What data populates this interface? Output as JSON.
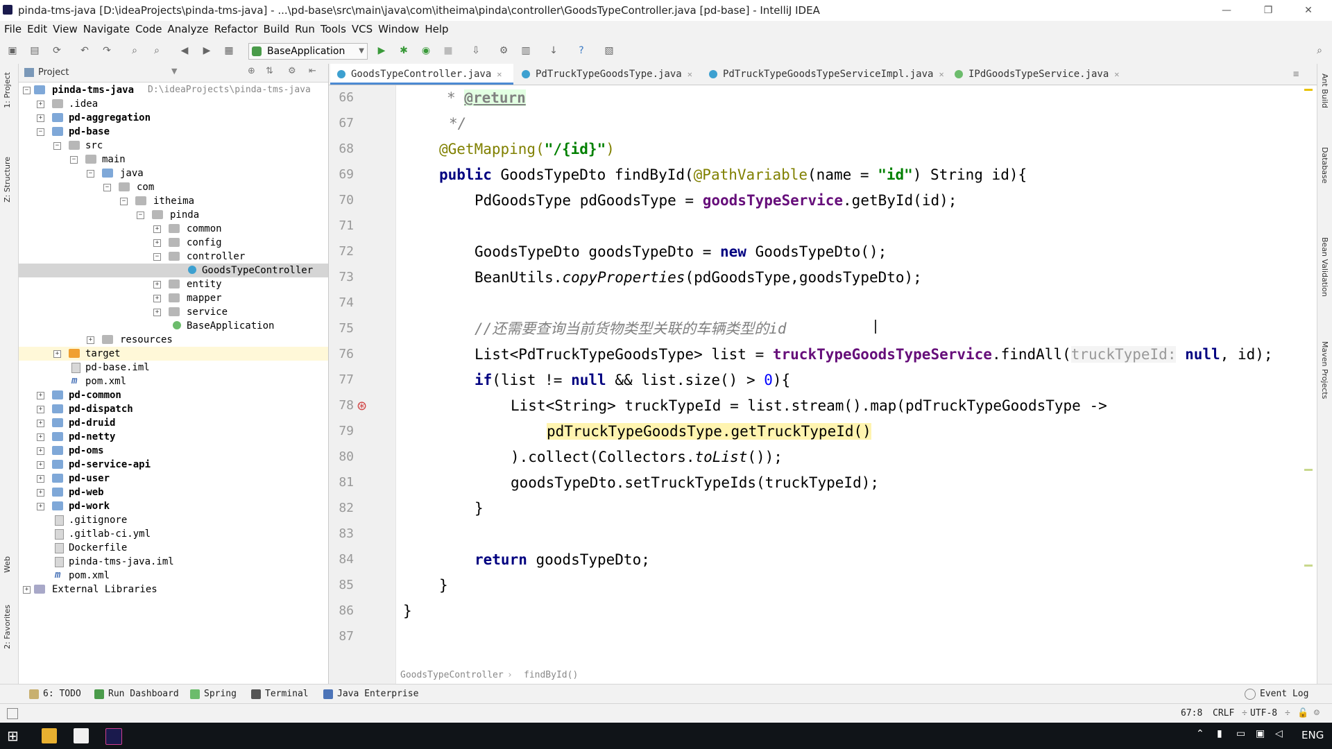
{
  "window": {
    "title": "pinda-tms-java [D:\\ideaProjects\\pinda-tms-java] - ...\\pd-base\\src\\main\\java\\com\\itheima\\pinda\\controller\\GoodsTypeController.java [pd-base] - IntelliJ IDEA",
    "minimize": "—",
    "maximize": "❐",
    "close": "✕"
  },
  "menu": [
    "File",
    "Edit",
    "View",
    "Navigate",
    "Code",
    "Analyze",
    "Refactor",
    "Build",
    "Run",
    "Tools",
    "VCS",
    "Window",
    "Help"
  ],
  "toolbar": {
    "run_config": "BaseApplication"
  },
  "left_strip": {
    "project": "1: Project",
    "structure": "Z: Structure",
    "web": "Web",
    "favorites": "2: Favorites"
  },
  "right_strip": {
    "ant": "Ant Build",
    "database": "Database",
    "bean": "Bean Validation",
    "maven": "Maven Projects"
  },
  "project_panel": {
    "title": "Project",
    "tree": [
      {
        "label": "pinda-tms-java",
        "path": "D:\\ideaProjects\\pinda-tms-java",
        "bold": true
      },
      {
        "label": ".idea"
      },
      {
        "label": "pd-aggregation",
        "bold": true
      },
      {
        "label": "pd-base",
        "bold": true
      },
      {
        "label": "src"
      },
      {
        "label": "main"
      },
      {
        "label": "java"
      },
      {
        "label": "com"
      },
      {
        "label": "itheima"
      },
      {
        "label": "pinda"
      },
      {
        "label": "common"
      },
      {
        "label": "config"
      },
      {
        "label": "controller"
      },
      {
        "label": "GoodsTypeController"
      },
      {
        "label": "entity"
      },
      {
        "label": "mapper"
      },
      {
        "label": "service"
      },
      {
        "label": "BaseApplication"
      },
      {
        "label": "resources"
      },
      {
        "label": "target"
      },
      {
        "label": "pd-base.iml"
      },
      {
        "label": "pom.xml"
      },
      {
        "label": "pd-common",
        "bold": true
      },
      {
        "label": "pd-dispatch",
        "bold": true
      },
      {
        "label": "pd-druid",
        "bold": true
      },
      {
        "label": "pd-netty",
        "bold": true
      },
      {
        "label": "pd-oms",
        "bold": true
      },
      {
        "label": "pd-service-api",
        "bold": true
      },
      {
        "label": "pd-user",
        "bold": true
      },
      {
        "label": "pd-web",
        "bold": true
      },
      {
        "label": "pd-work",
        "bold": true
      },
      {
        "label": ".gitignore"
      },
      {
        "label": ".gitlab-ci.yml"
      },
      {
        "label": "Dockerfile"
      },
      {
        "label": "pinda-tms-java.iml"
      },
      {
        "label": "pom.xml"
      },
      {
        "label": "External Libraries"
      }
    ]
  },
  "editor": {
    "tabs": [
      {
        "label": "GoodsTypeController.java",
        "active": true
      },
      {
        "label": "PdTruckTypeGoodsType.java"
      },
      {
        "label": "PdTruckTypeGoodsTypeServiceImpl.java"
      },
      {
        "label": "IPdGoodsTypeService.java"
      }
    ],
    "line_numbers": [
      "66",
      "67",
      "68",
      "69",
      "70",
      "71",
      "72",
      "73",
      "74",
      "75",
      "76",
      "77",
      "78",
      "79",
      "80",
      "81",
      "82",
      "83",
      "84",
      "85",
      "86",
      "87"
    ],
    "code": {
      "l66_doc": "@return",
      "l66_star": "* ",
      "l67": "*/",
      "l68_ann": "@GetMapping(",
      "l68_str": "\"/{id}\"",
      "l68_end": ")",
      "l69_kw": "public",
      "l69_a": " GoodsTypeDto findById(",
      "l69_ann": "@PathVariable",
      "l69_b": "(name = ",
      "l69_str": "\"id\"",
      "l69_c": ") String id){",
      "l70_a": "PdGoodsType pdGoodsType = ",
      "l70_fld": "goodsTypeService",
      "l70_b": ".getById(id);",
      "l72_a": "GoodsTypeDto goodsTypeDto = ",
      "l72_kw": "new",
      "l72_b": " GoodsTypeDto();",
      "l73_a": "BeanUtils.",
      "l73_it": "copyProperties",
      "l73_b": "(pdGoodsType,goodsTypeDto);",
      "l75_cmt": "//还需要查询当前货物类型关联的车辆类型的id",
      "l76_a": "List<PdTruckTypeGoodsType> list = ",
      "l76_fld": "truckTypeGoodsTypeService",
      "l76_b": ".findAll(",
      "l76_hint": "truckTypeId:",
      "l76_null": " null",
      "l76_c": ", id);",
      "l77_kw1": "if",
      "l77_a": "(list != ",
      "l77_kw2": "null",
      "l77_b": " && list.size() > ",
      "l77_num": "0",
      "l77_c": "){",
      "l78": "List<String> truckTypeId = list.stream().map(pdTruckTypeGoodsType ->",
      "l79": "pdTruckTypeGoodsType.getTruckTypeId()",
      "l80_a": ").collect(Collectors.",
      "l80_it": "toList",
      "l80_b": "());",
      "l81": "goodsTypeDto.setTruckTypeIds(truckTypeId);",
      "l82": "}",
      "l84_kw": "return",
      "l84_a": " goodsTypeDto;",
      "l85": "}",
      "l86": "}"
    },
    "breadcrumb": [
      "GoodsTypeController",
      "findById()"
    ]
  },
  "bottom_tabs": [
    "6: TODO",
    "Run Dashboard",
    "Spring",
    "Terminal",
    "Java Enterprise"
  ],
  "event_log": "Event Log",
  "status": {
    "position": "67:8",
    "line_sep": "CRLF",
    "encoding": "UTF-8"
  },
  "taskbar": {
    "lang": "ENG"
  }
}
